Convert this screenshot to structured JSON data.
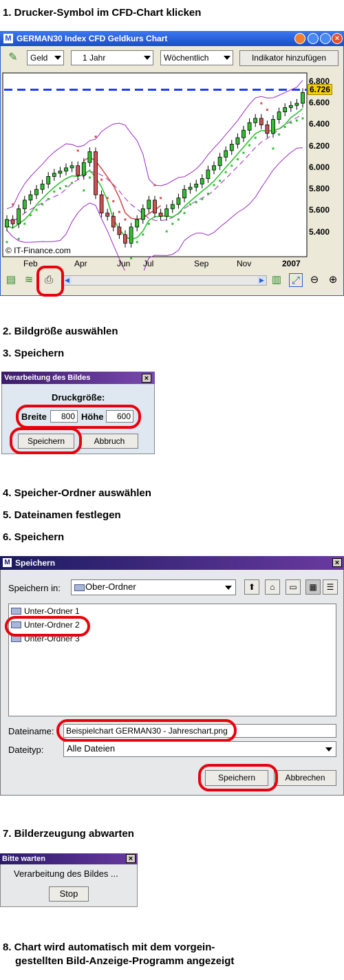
{
  "steps": {
    "s1": "1. Drucker-Symbol im CFD-Chart klicken",
    "s2": "2. Bildgröße auswählen",
    "s3": "3. Speichern",
    "s4": "4. Speicher-Ordner auswählen",
    "s5": "5. Dateinamen festlegen",
    "s6": "6. Speichern",
    "s7": "7. Bilderzeugung abwarten",
    "s8a": "8. Chart wird automatisch mit dem vorgein-",
    "s8b": "gestellten Bild-Anzeige-Programm angezeigt"
  },
  "chart_window": {
    "title": "GERMAN30 Index CFD Geldkurs Chart",
    "combo_price": "Geld",
    "combo_period": "1 Jahr",
    "combo_interval": "Wöchentlich",
    "indicator_button": "Indikator hinzufügen",
    "copyright": "© IT-Finance.com",
    "current_value": "6.726",
    "y_ticks": [
      "6.800",
      "6.600",
      "6.400",
      "6.200",
      "6.000",
      "5.800",
      "5.600",
      "5.400"
    ],
    "x_ticks": [
      "Feb",
      "Apr",
      "Jun",
      "Jul",
      "Sep",
      "Nov",
      "2007"
    ],
    "colors": {
      "title_bar": "#2a5cd8",
      "dashed_line": "#1e3cf0",
      "bollinger": "#9a28c8",
      "moving_avg": "#d05050",
      "trend": "#30c030",
      "value_badge": "#f5d000"
    }
  },
  "chart_data": {
    "type": "candlestick",
    "y_ticks": [
      5.4,
      5.6,
      5.8,
      6.0,
      6.2,
      6.4,
      6.6,
      6.8
    ],
    "ylim": [
      5.2,
      6.85
    ],
    "x_ticks": [
      "Feb",
      "Apr",
      "Jun",
      "Jul",
      "Sep",
      "Nov",
      "2007"
    ],
    "current_value": 6.726,
    "closes": [
      5.52,
      5.48,
      5.62,
      5.7,
      5.75,
      5.8,
      5.85,
      5.92,
      5.95,
      5.97,
      6.0,
      6.02,
      5.93,
      6.05,
      6.15,
      5.75,
      5.58,
      5.55,
      5.45,
      5.38,
      5.3,
      5.45,
      5.52,
      5.62,
      5.7,
      5.58,
      5.55,
      5.62,
      5.66,
      5.72,
      5.8,
      5.82,
      5.85,
      5.9,
      5.98,
      6.02,
      6.1,
      6.16,
      6.22,
      6.28,
      6.35,
      6.42,
      6.46,
      6.4,
      6.32,
      6.45,
      6.52,
      6.56,
      6.58,
      6.6,
      6.7
    ],
    "opens": [
      5.45,
      5.52,
      5.48,
      5.62,
      5.7,
      5.75,
      5.8,
      5.85,
      5.92,
      5.95,
      5.97,
      6.0,
      6.02,
      5.93,
      6.05,
      6.15,
      5.75,
      5.58,
      5.55,
      5.45,
      5.38,
      5.3,
      5.45,
      5.52,
      5.62,
      5.7,
      5.58,
      5.55,
      5.62,
      5.66,
      5.72,
      5.8,
      5.82,
      5.85,
      5.9,
      5.98,
      6.02,
      6.1,
      6.16,
      6.22,
      6.28,
      6.35,
      6.42,
      6.46,
      6.4,
      6.32,
      6.45,
      6.52,
      6.56,
      6.58,
      6.6
    ]
  },
  "size_dialog": {
    "title": "Verarbeitung des Bildes",
    "heading": "Druckgröße:",
    "width_label": "Breite",
    "width_value": "800",
    "height_label": "Höhe",
    "height_value": "600",
    "save": "Speichern",
    "cancel": "Abbruch"
  },
  "save_dialog": {
    "title": "Speichern",
    "save_in_label": "Speichern in:",
    "folder": "Ober-Ordner",
    "items": [
      "Unter-Ordner 1",
      "Unter-Ordner 2",
      "Unter-Ordner 3"
    ],
    "filename_label": "Dateiname:",
    "filename": "Beispielchart GERMAN30 - Jahreschart.png",
    "filetype_label": "Dateityp:",
    "filetype": "Alle Dateien",
    "save": "Speichern",
    "cancel": "Abbrechen"
  },
  "wait_dialog": {
    "title": "Bitte warten",
    "message": "Verarbeitung des Bildes ...",
    "stop": "Stop"
  }
}
